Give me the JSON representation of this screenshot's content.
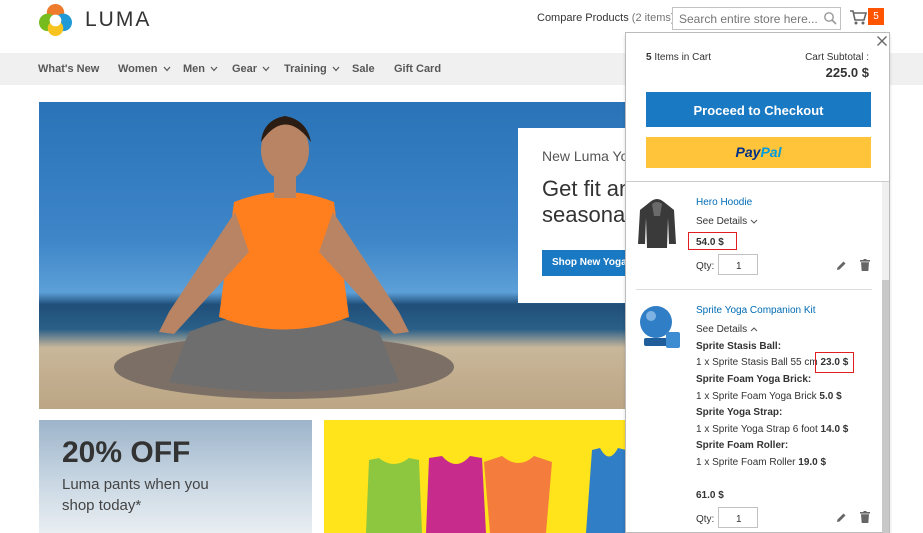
{
  "header": {
    "logo_text": "LUMA",
    "compare_label": "Compare Products",
    "compare_count": "(2 items)",
    "search_placeholder": "Search entire store here...",
    "cart_count": "5"
  },
  "nav": {
    "items": [
      {
        "label": "What's New",
        "has_dropdown": false
      },
      {
        "label": "Women",
        "has_dropdown": true
      },
      {
        "label": "Men",
        "has_dropdown": true
      },
      {
        "label": "Gear",
        "has_dropdown": true
      },
      {
        "label": "Training",
        "has_dropdown": true
      },
      {
        "label": "Sale",
        "has_dropdown": false
      },
      {
        "label": "Gift Card",
        "has_dropdown": false
      }
    ]
  },
  "hero": {
    "kicker": "New Luma Yoga Collection",
    "title_line1": "Get fit and look fab in new",
    "title_line2": "seasonal styles",
    "button": "Shop New Yoga"
  },
  "promo": {
    "discount": "20% OFF",
    "text": "Luma pants when you shop today*"
  },
  "minicart": {
    "items_count": "5",
    "items_in_cart_label": "Items in Cart",
    "subtotal_label": "Cart Subtotal :",
    "subtotal": "225.0 $",
    "checkout_label": "Proceed to Checkout",
    "paypal_pay": "Pay",
    "paypal_pal": "Pal",
    "see_details": "See Details",
    "qty_label": "Qty:",
    "items": [
      {
        "name": "Hero Hoodie",
        "price": "54.0 $",
        "qty": "1"
      },
      {
        "name": "Sprite Yoga Companion Kit",
        "price": "61.0 $",
        "qty": "1",
        "options": [
          {
            "title": "Sprite Stasis Ball:",
            "value": "1 x Sprite Stasis Ball 55 cm",
            "price": "23.0 $"
          },
          {
            "title": "Sprite Foam Yoga Brick:",
            "value": "1 x Sprite Foam Yoga Brick",
            "price": "5.0 $"
          },
          {
            "title": "Sprite Yoga Strap:",
            "value": "1 x Sprite Yoga Strap 6 foot",
            "price": "14.0 $"
          },
          {
            "title": "Sprite Foam Roller:",
            "value": "1 x Sprite Foam Roller",
            "price": "19.0 $"
          }
        ]
      }
    ]
  },
  "colors": {
    "accent_blue": "#1979c3",
    "cart_badge": "#ff5501",
    "paypal_yellow": "#ffc439",
    "highlight_red": "#e02020"
  }
}
